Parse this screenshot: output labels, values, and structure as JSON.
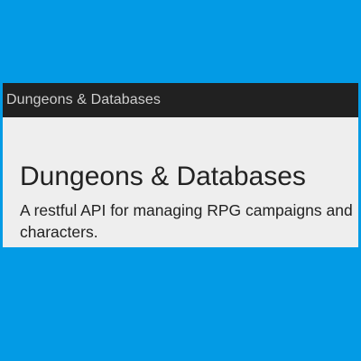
{
  "navbar": {
    "brand": "Dungeons & Databases"
  },
  "hero": {
    "title": "Dungeons & Databases",
    "subtitle": "A restful API for managing RPG campaigns and characters."
  },
  "colors": {
    "page_background": "#039be5",
    "navbar_background": "#212121",
    "navbar_text": "#cfcfcf",
    "content_background": "#eeeeee",
    "heading_text": "#222222"
  }
}
